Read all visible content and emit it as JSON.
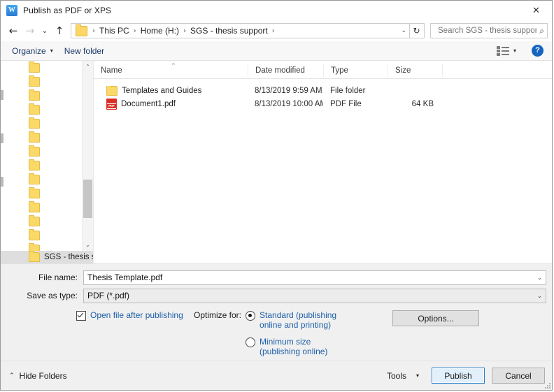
{
  "window": {
    "title": "Publish as PDF or XPS",
    "app_icon": "word-icon",
    "close_label": "✕"
  },
  "navigation": {
    "back_icon": "←",
    "forward_icon": "→",
    "recent_icon": "⌄",
    "up_icon": "↑",
    "refresh_icon": "↻",
    "breadcrumbs": [
      "This PC",
      "Home (H:)",
      "SGS - thesis support"
    ],
    "separator": "›",
    "dropdown_icon": "⌄"
  },
  "search": {
    "placeholder": "Search SGS - thesis support",
    "value": "",
    "icon": "⌕"
  },
  "toolbar": {
    "organize_label": "Organize",
    "organize_caret": "▾",
    "new_folder_label": "New folder",
    "view_icon": "view-options-icon",
    "view_caret": "▾",
    "help_label": "?"
  },
  "nav_pane": {
    "items": [
      {
        "label": ""
      },
      {
        "label": ""
      },
      {
        "label": ""
      },
      {
        "label": ""
      },
      {
        "label": ""
      },
      {
        "label": ""
      },
      {
        "label": ""
      },
      {
        "label": ""
      },
      {
        "label": ""
      },
      {
        "label": ""
      },
      {
        "label": ""
      },
      {
        "label": ""
      },
      {
        "label": ""
      },
      {
        "label": ""
      },
      {
        "label": ""
      }
    ],
    "selected_item": {
      "label": "SGS - thesis s"
    },
    "scroll_up_icon": "⌃",
    "scroll_down_icon": "⌄"
  },
  "file_list": {
    "columns": [
      "Name",
      "Date modified",
      "Type",
      "Size"
    ],
    "sort_indicator": "⌃",
    "rows": [
      {
        "icon": "folder-icon",
        "name": "Templates and Guides",
        "date_modified": "8/13/2019 9:59 AM",
        "type": "File folder",
        "size": ""
      },
      {
        "icon": "pdf-icon",
        "name": "Document1.pdf",
        "date_modified": "8/13/2019 10:00 AM",
        "type": "PDF File",
        "size": "64 KB"
      }
    ],
    "pdf_badge": "PDF"
  },
  "form": {
    "file_name_label": "File name:",
    "file_name_value": "Thesis Template.pdf",
    "save_as_type_label": "Save as type:",
    "save_as_type_value": "PDF (*.pdf)",
    "combo_arrow": "⌄"
  },
  "options": {
    "open_after_publishing_label": "Open file after publishing",
    "open_after_publishing_checked": true,
    "optimize_label": "Optimize for:",
    "radios": [
      {
        "label": "Standard (publishing online and printing)",
        "selected": true
      },
      {
        "label": "Minimum size (publishing online)",
        "selected": false
      }
    ],
    "options_button_label": "Options..."
  },
  "footer": {
    "hide_folders_label": "Hide Folders",
    "hide_folders_icon": "⌃",
    "tools_label": "Tools",
    "tools_caret": "▾",
    "publish_label": "Publish",
    "cancel_label": "Cancel"
  },
  "colors": {
    "accent_blue": "#1c5fa8",
    "default_button_border": "#2a7fc9",
    "folder_yellow": "#fbd968",
    "pdf_red": "#d93025",
    "help_blue": "#1565c0"
  }
}
